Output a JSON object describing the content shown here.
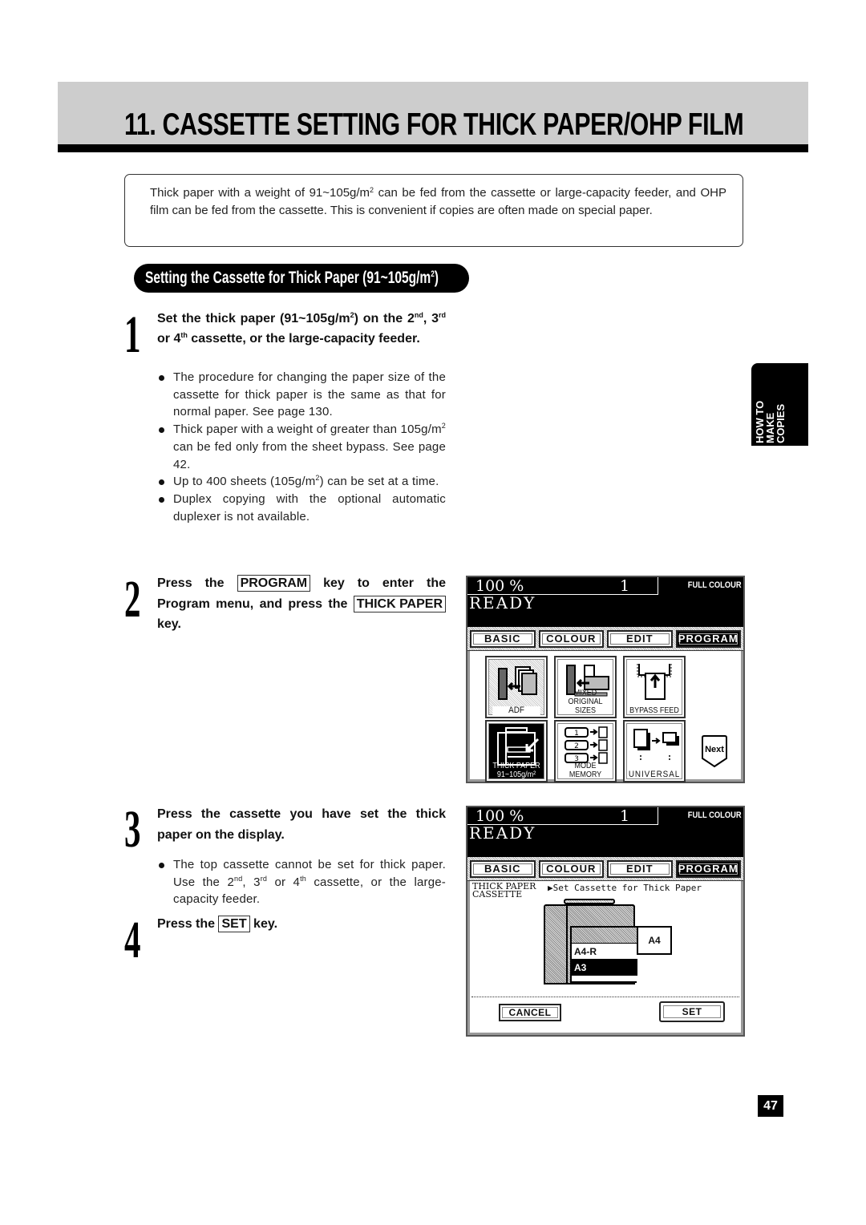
{
  "header": {
    "title": "11. CASSETTE SETTING FOR THICK PAPER/OHP FILM"
  },
  "intro": {
    "text_1": "Thick paper with a weight of 91~105g/m",
    "sup": "2",
    "text_2": " can be fed from the cassette or large-capacity feeder, and OHP film can be fed from the cassette. This is convenient if copies are often made on special paper."
  },
  "section": {
    "title_1": "Setting the Cassette for Thick Paper (91~105g/m",
    "sup": "2",
    "title_2": ")"
  },
  "side_tab": {
    "lines": [
      "HOW TO",
      "MAKE",
      "COPIES"
    ]
  },
  "steps": [
    {
      "number": "1",
      "head_a": "Set the thick paper (91~105g/m",
      "head_a_sup": "2",
      "head_b": ") on the ",
      "ord2": "2",
      "ord2_sup": "nd",
      "ord3": ", 3",
      "ord3_sup": "rd",
      "ord4": " or 4",
      "ord4_sup": "th",
      "head_c": " cassette, or the large-capacity feeder.",
      "bullets": [
        {
          "text": "The procedure for changing the paper size of the cassette for thick paper is the same as that for normal paper. See page 130."
        },
        {
          "text_a": "Thick paper with a weight of greater than 105g/m",
          "sup": "2",
          "text_b": " can be fed only from the sheet bypass. See page 42."
        },
        {
          "text_a": "Up to 400 sheets (105g/m",
          "sup": "2",
          "text_b": ") can be set at a time."
        },
        {
          "text": "Duplex copying with the optional automatic duplexer is not available."
        }
      ]
    },
    {
      "number": "2",
      "head_a": "Press the ",
      "key1": "PROGRAM",
      "head_b": " key to enter the Program menu, and press the ",
      "key2": "THICK PAPER",
      "head_c": " key."
    },
    {
      "number": "3",
      "head": "Press the cassette you have set the thick paper on the display.",
      "bullet_a": "The top cassette cannot be set for thick paper. Use the 2",
      "sup1": "nd",
      "bullet_b": ", 3",
      "sup2": "rd",
      "bullet_c": " or 4",
      "sup3": "th",
      "bullet_d": " cassette, or the large-capacity feeder."
    },
    {
      "number": "4",
      "head_a": "Press the ",
      "key": "SET",
      "head_b": " key."
    }
  ],
  "screen1": {
    "zoom": "100 %",
    "count": "1",
    "mode": "FULL COLOUR",
    "status": "READY",
    "tabs": [
      "BASIC",
      "COLOUR",
      "EDIT",
      "PROGRAM"
    ],
    "active_tab": "PROGRAM",
    "keys": [
      {
        "label": "ADF",
        "icon": "adf-icon"
      },
      {
        "label_1": "MIXED",
        "label_2": "ORIGINAL SIZES",
        "icon": "mixed-sizes-icon"
      },
      {
        "label": "BYPASS FEED",
        "icon": "bypass-feed-icon"
      },
      {
        "label_1": "THICK PAPER",
        "label_2": "91~105g/m²",
        "icon": "thick-paper-icon",
        "selected": true
      },
      {
        "label": "MODE MEMORY",
        "icon": "mode-memory-icon",
        "slots": [
          "1",
          "2",
          "3"
        ]
      },
      {
        "label": "UNIVERSAL",
        "icon": "universal-icon"
      }
    ],
    "next_label": "Next"
  },
  "screen2": {
    "zoom": "100 %",
    "count": "1",
    "mode": "FULL COLOUR",
    "status": "READY",
    "tabs": [
      "BASIC",
      "COLOUR",
      "EDIT",
      "PROGRAM"
    ],
    "active_tab": "PROGRAM",
    "function_label_1": "THICK PAPER",
    "function_label_2": "CASSETTE",
    "message": "▶Set Cassette for Thick Paper",
    "cassettes": [
      "",
      "A4-R",
      "A3",
      ""
    ],
    "selected_cassette": "A3",
    "lcf_size": "A4",
    "cancel_label": "CANCEL",
    "set_label": "SET"
  },
  "page_number": "47"
}
